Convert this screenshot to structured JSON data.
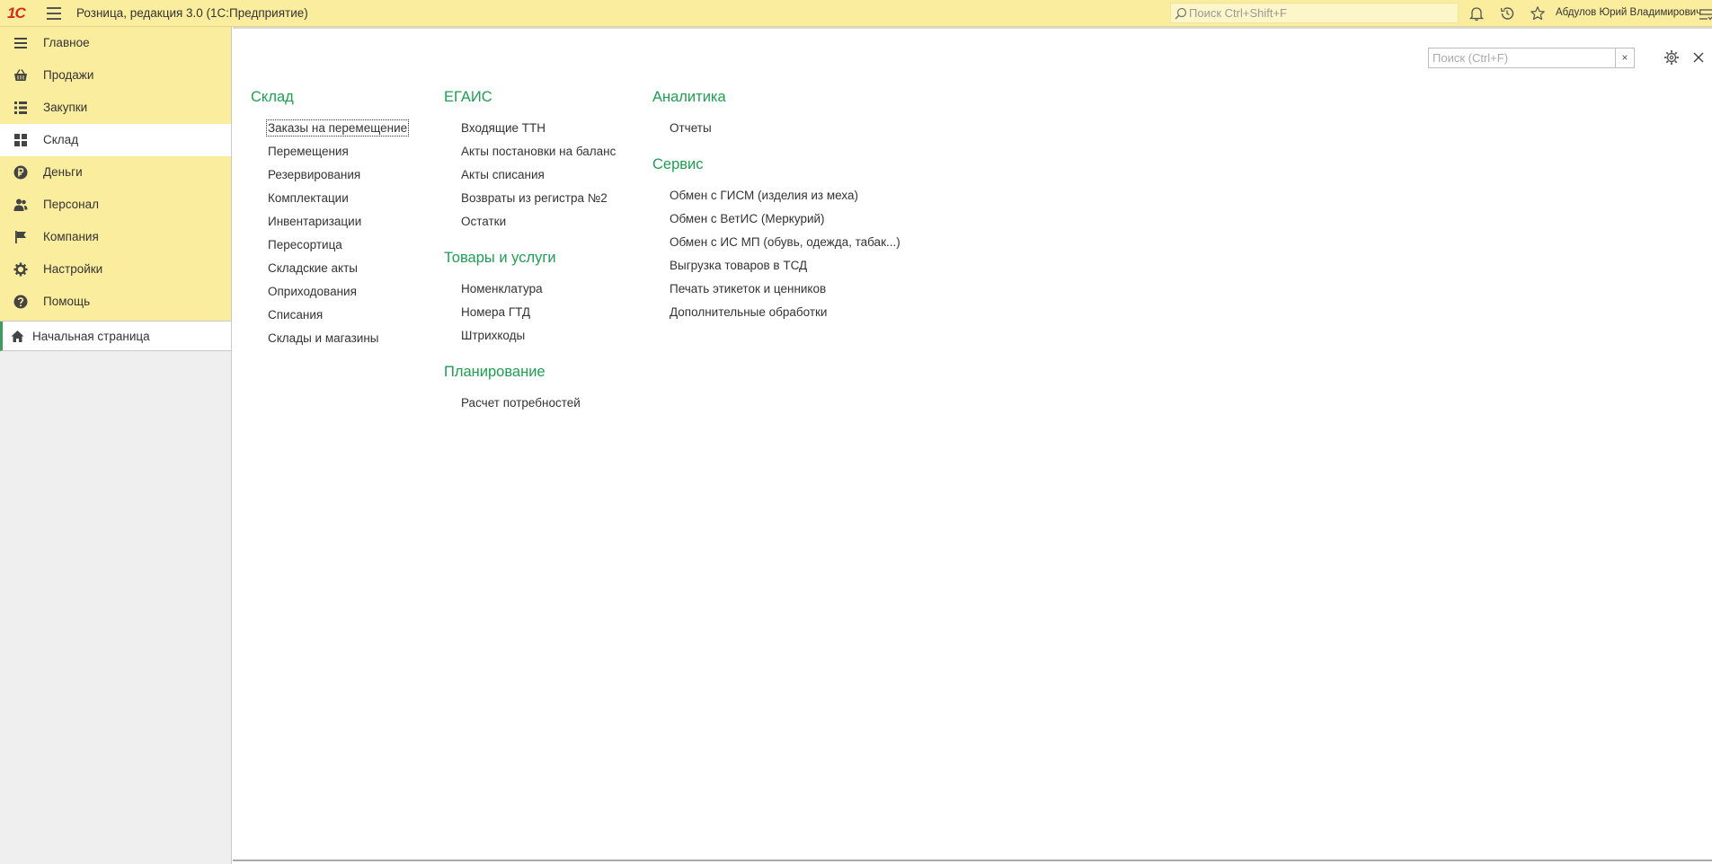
{
  "header": {
    "app_title": "Розница, редакция 3.0  (1С:Предприятие)",
    "logo_text": "1С",
    "search_placeholder": "Поиск Ctrl+Shift+F",
    "user_name": "Абдулов Юрий Владимирович",
    "icons": [
      "menu-icon",
      "bell-icon",
      "history-icon",
      "star-icon",
      "user-menu-icon"
    ]
  },
  "sidebar": {
    "sections": [
      {
        "label": "Главное",
        "icon": "list-icon"
      },
      {
        "label": "Продажи",
        "icon": "basket-icon"
      },
      {
        "label": "Закупки",
        "icon": "purchases-icon"
      },
      {
        "label": "Склад",
        "icon": "warehouse-icon",
        "active": true
      },
      {
        "label": "Деньги",
        "icon": "ruble-icon"
      },
      {
        "label": "Персонал",
        "icon": "people-icon"
      },
      {
        "label": "Компания",
        "icon": "flag-icon"
      },
      {
        "label": "Настройки",
        "icon": "gear-icon"
      },
      {
        "label": "Помощь",
        "icon": "help-icon"
      }
    ],
    "open_windows": [
      {
        "label": "Начальная страница",
        "icon": "home-icon"
      }
    ]
  },
  "panel": {
    "search_placeholder": "Поиск (Ctrl+F)",
    "clear_label": "×",
    "groups": {
      "sklad": {
        "title": "Склад",
        "items": [
          "Заказы на перемещение",
          "Перемещения",
          "Резервирования",
          "Комплектации",
          "Инвентаризации",
          "Пересортица",
          "Складские акты",
          "Оприходования",
          "Списания",
          "Склады и магазины"
        ]
      },
      "egais": {
        "title": "ЕГАИС",
        "items": [
          "Входящие ТТН",
          "Акты постановки на баланс",
          "Акты списания",
          "Возвраты из регистра №2",
          "Остатки"
        ]
      },
      "tovary": {
        "title": "Товары и услуги",
        "items": [
          "Номенклатура",
          "Номера ГТД",
          "Штрихкоды"
        ]
      },
      "planning": {
        "title": "Планирование",
        "items": [
          "Расчет потребностей"
        ]
      },
      "analytics": {
        "title": "Аналитика",
        "items": [
          "Отчеты"
        ]
      },
      "service": {
        "title": "Сервис",
        "items": [
          "Обмен с ГИСМ (изделия из меха)",
          "Обмен с ВетИС (Меркурий)",
          "Обмен с ИС МП (обувь, одежда, табак...)",
          "Выгрузка товаров в ТСД",
          "Печать этикеток и ценников",
          "Дополнительные обработки"
        ]
      }
    }
  },
  "colors": {
    "topbar": "#fbed9e",
    "sidebar_sections": "#fbed9e",
    "group_title": "#1e9e50",
    "active_marker": "#3d9e5a"
  }
}
